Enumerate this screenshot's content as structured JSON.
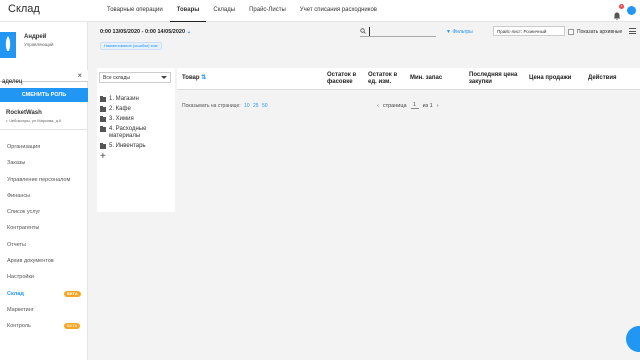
{
  "app": {
    "title": "Склад",
    "notifications_count": "3"
  },
  "tabs": [
    {
      "label": "Товарные операции"
    },
    {
      "label": "Товары"
    },
    {
      "label": "Склады"
    },
    {
      "label": "Прайс-Листы"
    },
    {
      "label": "Учет списания расходников"
    }
  ],
  "sidebar": {
    "user_name": "Андрей",
    "user_role": "Управляющий",
    "search_value": "аделец",
    "change_role_label": "СМЕНИТЬ РОЛЬ",
    "company_name": "RocketWash",
    "company_address": "г. Чебоксары, ул Маркова, д.6",
    "items": [
      {
        "label": "Организация"
      },
      {
        "label": "Заказы"
      },
      {
        "label": "Управление персоналом"
      },
      {
        "label": "Финансы"
      },
      {
        "label": "Список услуг"
      },
      {
        "label": "Контрагенты"
      },
      {
        "label": "Отчеты"
      },
      {
        "label": "Архив документов"
      },
      {
        "label": "Настройки"
      },
      {
        "label": "Склад",
        "badge": "BETA"
      },
      {
        "label": "Маркетинг"
      },
      {
        "label": "Контроль",
        "badge": "BETA"
      }
    ]
  },
  "header": {
    "date_range": "0:00 13/05/2020 - 0:00 14/05/2020",
    "chip": "Наименование (ошибки) хим",
    "search_value": "",
    "filters_label": "Фильтры",
    "pricelist_value": "Прайс-лист: Розничный",
    "archive_label": "Показать архивные"
  },
  "warehouse": {
    "select_value": "Все склады",
    "tree": [
      {
        "label": "1. Магазин"
      },
      {
        "label": "2. Кафе"
      },
      {
        "label": "3. Химия"
      },
      {
        "label": "4. Расходные материалы"
      },
      {
        "label": "5. Инвентарь"
      }
    ]
  },
  "table": {
    "columns": [
      {
        "label": "Товар"
      },
      {
        "label": "Остаток в фасовке"
      },
      {
        "label": "Остаток в ед. изм."
      },
      {
        "label": "Мин. запас"
      },
      {
        "label": "Последняя цена закупки"
      },
      {
        "label": "Цена продажи"
      },
      {
        "label": "Действия"
      }
    ],
    "per_page_label": "Показывать на странице:",
    "per_page_options": [
      "10",
      "25",
      "50"
    ],
    "page_label": "страница",
    "page_value": "1",
    "of_label": "из 1"
  },
  "colors": {
    "accent": "#2196f3",
    "beta": "#f5a623"
  }
}
